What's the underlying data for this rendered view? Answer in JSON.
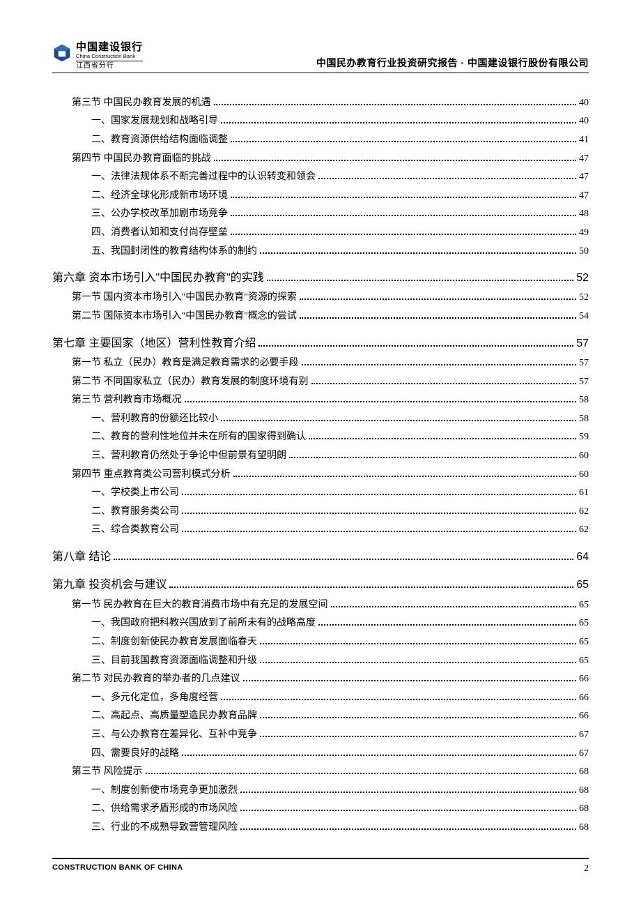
{
  "header": {
    "logo_cn": "中国建设银行",
    "logo_en": "China Construction Bank",
    "logo_sub": "江西省分行",
    "right": "中国民办教育行业投资研究报告 · 中国建设银行股份有限公司"
  },
  "toc": [
    {
      "level": 2,
      "title": "第三节 中国民办教育发展的机遇",
      "page": "40"
    },
    {
      "level": 3,
      "title": "一、国家发展规划和战略引导",
      "page": "40"
    },
    {
      "level": 3,
      "title": "二、教育资源供给结构面临调整",
      "page": "41"
    },
    {
      "level": 2,
      "title": "第四节 中国民办教育面临的挑战",
      "page": "47"
    },
    {
      "level": 3,
      "title": "一、法律法规体系不断完善过程中的认识转变和领会",
      "page": "47"
    },
    {
      "level": 3,
      "title": "二、经济全球化形成新市场环境",
      "page": "47"
    },
    {
      "level": 3,
      "title": "三、公办学校改革加剧市场竞争",
      "page": "48"
    },
    {
      "level": 3,
      "title": "四、消费者认知和支付尚存壁垒",
      "page": "49"
    },
    {
      "level": 3,
      "title": "五、我国封闭性的教育结构体系的制约",
      "page": "50"
    },
    {
      "level": 1,
      "title": "第六章 资本市场引入\"中国民办教育\"的实践",
      "page": "52"
    },
    {
      "level": 2,
      "title": "第一节 国内资本市场引入\"中国民办教育\"资源的探索",
      "page": "52"
    },
    {
      "level": 2,
      "title": "第二节 国际资本市场引入\"中国民办教育\"概念的尝试",
      "page": "54"
    },
    {
      "level": 1,
      "title": "第七章 主要国家（地区）营利性教育介绍",
      "page": "57"
    },
    {
      "level": 2,
      "title": "第一节 私立（民办）教育是满足教育需求的必要手段",
      "page": "57"
    },
    {
      "level": 2,
      "title": "第二节 不同国家私立（民办）教育发展的制度环境有别",
      "page": "57"
    },
    {
      "level": 2,
      "title": "第三节 营利教育市场概况",
      "page": "58"
    },
    {
      "level": 3,
      "title": "一、营利教育的份额还比较小",
      "page": "58"
    },
    {
      "level": 3,
      "title": "二、教育的营利性地位并未在所有的国家得到确认",
      "page": "59"
    },
    {
      "level": 3,
      "title": "三、营利教育仍然处于争论中但前景有望明朗",
      "page": "60"
    },
    {
      "level": 2,
      "title": "第四节 重点教育类公司营利模式分析",
      "page": "60"
    },
    {
      "level": 3,
      "title": "一、学校类上市公司",
      "page": "61"
    },
    {
      "level": 3,
      "title": "二、教育服务类公司",
      "page": "62"
    },
    {
      "level": 3,
      "title": "三、综合类教育公司",
      "page": "62"
    },
    {
      "level": 1,
      "title": "第八章 结论",
      "page": "64"
    },
    {
      "level": 1,
      "title": "第九章 投资机会与建议",
      "page": "65"
    },
    {
      "level": 2,
      "title": "第一节 民办教育在巨大的教育消费市场中有充足的发展空间",
      "page": "65"
    },
    {
      "level": 3,
      "title": "一、我国政府把科教兴国放到了前所未有的战略高度",
      "page": "65"
    },
    {
      "level": 3,
      "title": "二、制度创新使民办教育发展面临春天",
      "page": "65"
    },
    {
      "level": 3,
      "title": "三、目前我国教育资源面临调整和升级",
      "page": "65"
    },
    {
      "level": 2,
      "title": "第二节 对民办教育的举办者的几点建议",
      "page": "66"
    },
    {
      "level": 3,
      "title": "一、多元化定位，多角度经营",
      "page": "66"
    },
    {
      "level": 3,
      "title": "二、高起点、高质量塑造民办教育品牌",
      "page": "66"
    },
    {
      "level": 3,
      "title": "三、与公办教育在差异化、互补中竞争",
      "page": "67"
    },
    {
      "level": 3,
      "title": "四、需要良好的战略",
      "page": "67"
    },
    {
      "level": 2,
      "title": "第三节 风险提示",
      "page": "68"
    },
    {
      "level": 3,
      "title": "一、制度创新使市场竞争更加激烈",
      "page": "68"
    },
    {
      "level": 3,
      "title": "二、供给需求矛盾形成的市场风险",
      "page": "68"
    },
    {
      "level": 3,
      "title": "三、行业的不成熟导致营管理风险",
      "page": "68"
    }
  ],
  "footer": {
    "left": "CONSTRUCTION BANK OF CHINA",
    "right": "2"
  }
}
